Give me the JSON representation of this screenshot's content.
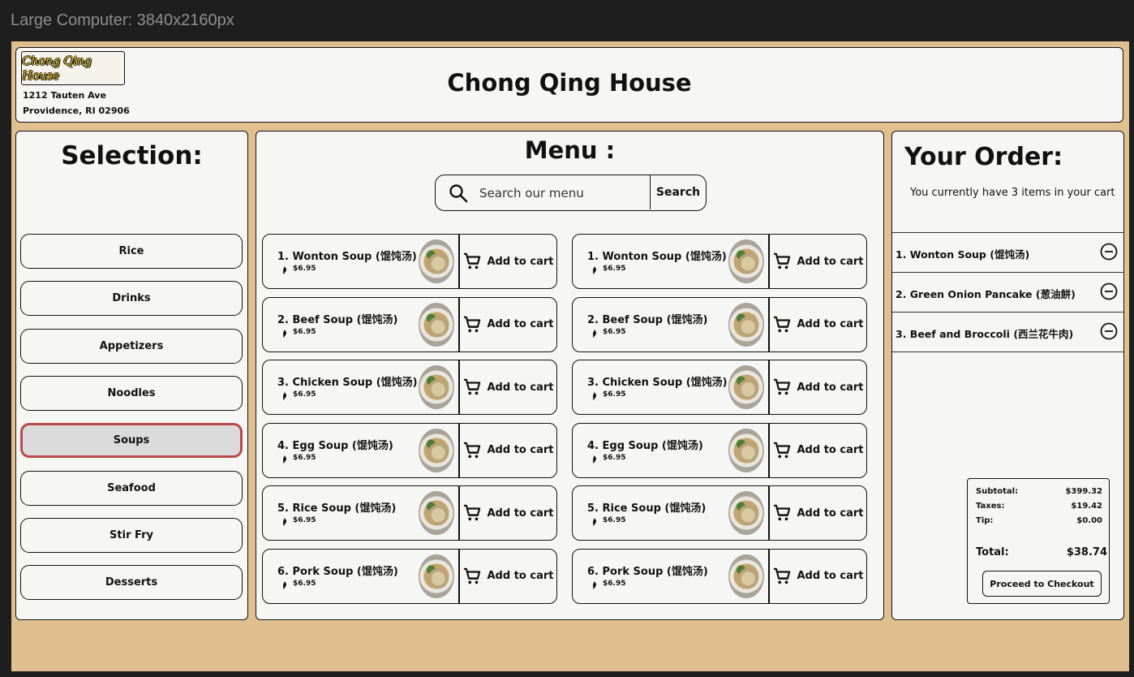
{
  "frame": {
    "label": "Large Computer: 3840x2160px"
  },
  "header": {
    "logo_text": "Chong Qing House",
    "address_line1": "1212 Tauten Ave",
    "address_line2": "Providence, RI 02906",
    "title": "Chong Qing House"
  },
  "selection": {
    "title": "Selection:",
    "categories": [
      "Rice",
      "Drinks",
      "Appetizers",
      "Noodles",
      "Soups",
      "Seafood",
      "Stir Fry",
      "Desserts"
    ],
    "active": "Soups"
  },
  "menu": {
    "title": "Menu :",
    "search_placeholder": "Search our menu",
    "search_button": "Search",
    "add_label": "Add to cart",
    "items_left": [
      {
        "name": "1. Wonton Soup (馄饨汤)",
        "price": "$6.95"
      },
      {
        "name": "2. Beef Soup (馄饨汤)",
        "price": "$6.95"
      },
      {
        "name": "3. Chicken Soup (馄饨汤)",
        "price": "$6.95"
      },
      {
        "name": "4. Egg Soup (馄饨汤)",
        "price": "$6.95"
      },
      {
        "name": "5. Rice Soup (馄饨汤)",
        "price": "$6.95"
      },
      {
        "name": "6. Pork Soup (馄饨汤)",
        "price": "$6.95"
      }
    ],
    "items_right": [
      {
        "name": "1. Wonton Soup (馄饨汤)",
        "price": "$6.95"
      },
      {
        "name": "2. Beef Soup (馄饨汤)",
        "price": "$6.95"
      },
      {
        "name": "3. Chicken Soup (馄饨汤)",
        "price": "$6.95"
      },
      {
        "name": "4. Egg Soup (馄饨汤)",
        "price": "$6.95"
      },
      {
        "name": "5. Rice Soup (馄饨汤)",
        "price": "$6.95"
      },
      {
        "name": "6. Pork Soup (馄饨汤)",
        "price": "$6.95"
      }
    ]
  },
  "order": {
    "title": "Your Order:",
    "cart_message": "You currently have 3 items in your cart",
    "items": [
      {
        "name": "1. Wonton Soup (馄饨汤)"
      },
      {
        "name": "2. Green Onion Pancake (葱油餅)"
      },
      {
        "name": "3. Beef and Broccoli (西兰花牛肉)"
      }
    ],
    "summary": {
      "subtotal_label": "Subtotal:",
      "subtotal": "$399.32",
      "taxes_label": "Taxes:",
      "taxes": "$19.42",
      "tip_label": "Tip:",
      "tip": "$0.00",
      "total_label": "Total:",
      "total": "$38.74"
    },
    "checkout_label": "Proceed to Checkout"
  },
  "colors": {
    "background": "#1e1e1e",
    "canvas": "#e0c08f",
    "panel": "#f6f6f4",
    "active_border": "#b94a4a",
    "logo_gold": "#d5b320"
  }
}
